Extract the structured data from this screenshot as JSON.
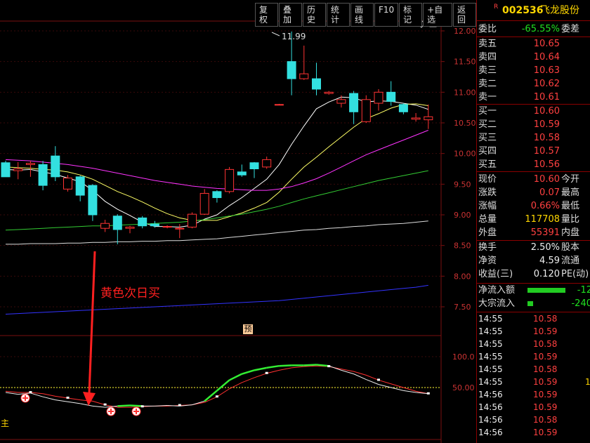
{
  "toolbar": [
    "复权",
    "叠加",
    "历史",
    "统计",
    "画线",
    "F10",
    "标记",
    "+自选",
    "返回"
  ],
  "stock": {
    "badge": "R",
    "code": "002536",
    "name": "飞龙股份"
  },
  "price_axis": [
    "12.00",
    "11.50",
    "11.00",
    "10.50",
    "10.00",
    "9.50",
    "9.00",
    "8.50",
    "8.00",
    "7.50"
  ],
  "indicator_axis": [
    "100.0",
    "50.00"
  ],
  "high_label": "11.99",
  "annotation": "黄色次日买",
  "yu_badge": "预",
  "left_cut_label": "主",
  "order_book": {
    "weibi": {
      "label": "委比",
      "value": "-65.55%",
      "right": "委差"
    },
    "sells": [
      {
        "label": "卖五",
        "price": "10.65"
      },
      {
        "label": "卖四",
        "price": "10.64"
      },
      {
        "label": "卖三",
        "price": "10.63"
      },
      {
        "label": "卖二",
        "price": "10.62"
      },
      {
        "label": "卖一",
        "price": "10.61"
      }
    ],
    "buys": [
      {
        "label": "买一",
        "price": "10.60"
      },
      {
        "label": "买二",
        "price": "10.59"
      },
      {
        "label": "买三",
        "price": "10.58"
      },
      {
        "label": "买四",
        "price": "10.57"
      },
      {
        "label": "买五",
        "price": "10.56"
      }
    ]
  },
  "quote": [
    {
      "label": "现价",
      "value": "10.60",
      "right": "今开",
      "color": "red"
    },
    {
      "label": "涨跌",
      "value": "0.07",
      "right": "最高",
      "color": "red"
    },
    {
      "label": "涨幅",
      "value": "0.66%",
      "right": "最低",
      "color": "red"
    },
    {
      "label": "总量",
      "value": "117708",
      "right": "量比",
      "color": "yellow"
    },
    {
      "label": "外盘",
      "value": "55391",
      "right": "内盘",
      "color": "red"
    }
  ],
  "fundamentals": [
    {
      "label": "换手",
      "value": "2.50%",
      "right": "股本"
    },
    {
      "label": "净资",
      "value": "4.59",
      "right": "流通"
    },
    {
      "label": "收益(三)",
      "value": "0.120",
      "right": "PE(动)"
    }
  ],
  "flows": [
    {
      "label": "净流入额",
      "value": "-12"
    },
    {
      "label": "大宗流入",
      "value": "-240"
    }
  ],
  "ticks": [
    {
      "time": "14:55",
      "price": "10.58",
      "extra": ""
    },
    {
      "time": "14:55",
      "price": "10.59",
      "extra": ""
    },
    {
      "time": "14:55",
      "price": "10.58",
      "extra": ""
    },
    {
      "time": "14:55",
      "price": "10.59",
      "extra": ""
    },
    {
      "time": "14:55",
      "price": "10.58",
      "extra": ""
    },
    {
      "time": "14:55",
      "price": "10.59",
      "extra": "1"
    },
    {
      "time": "14:56",
      "price": "10.59",
      "extra": ""
    },
    {
      "time": "14:56",
      "price": "10.59",
      "extra": ""
    },
    {
      "time": "14:56",
      "price": "10.58",
      "extra": ""
    },
    {
      "time": "14:56",
      "price": "10.59",
      "extra": ""
    }
  ],
  "candles": [
    {
      "o": 9.85,
      "h": 9.88,
      "l": 9.62,
      "c": 9.62
    },
    {
      "o": 9.72,
      "h": 9.86,
      "l": 9.58,
      "c": 9.75
    },
    {
      "o": 9.82,
      "h": 9.88,
      "l": 9.62,
      "c": 9.84
    },
    {
      "o": 9.82,
      "h": 9.88,
      "l": 9.4,
      "c": 9.48
    },
    {
      "o": 9.96,
      "h": 10.12,
      "l": 9.55,
      "c": 9.62
    },
    {
      "o": 9.42,
      "h": 9.65,
      "l": 9.38,
      "c": 9.6
    },
    {
      "o": 9.62,
      "h": 9.64,
      "l": 9.22,
      "c": 9.32
    },
    {
      "o": 9.48,
      "h": 9.5,
      "l": 8.9,
      "c": 9.0
    },
    {
      "o": 8.78,
      "h": 8.92,
      "l": 8.72,
      "c": 8.86
    },
    {
      "o": 8.98,
      "h": 9.01,
      "l": 8.52,
      "c": 8.76
    },
    {
      "o": 8.78,
      "h": 8.82,
      "l": 8.7,
      "c": 8.8
    },
    {
      "o": 8.95,
      "h": 8.98,
      "l": 8.78,
      "c": 8.82
    },
    {
      "o": 8.85,
      "h": 8.9,
      "l": 8.79,
      "c": 8.82
    },
    {
      "o": 8.8,
      "h": 8.83,
      "l": 8.78,
      "c": 8.81
    },
    {
      "o": 8.78,
      "h": 8.85,
      "l": 8.62,
      "c": 8.78
    },
    {
      "o": 8.8,
      "h": 9.04,
      "l": 8.78,
      "c": 9.01
    },
    {
      "o": 9.01,
      "h": 9.42,
      "l": 9.0,
      "c": 9.35
    },
    {
      "o": 9.38,
      "h": 9.4,
      "l": 9.2,
      "c": 9.28
    },
    {
      "o": 9.38,
      "h": 9.78,
      "l": 9.35,
      "c": 9.74
    },
    {
      "o": 9.7,
      "h": 9.82,
      "l": 9.62,
      "c": 9.65
    },
    {
      "o": 9.85,
      "h": 9.86,
      "l": 9.6,
      "c": 9.75
    },
    {
      "o": 9.78,
      "h": 9.95,
      "l": 9.75,
      "c": 9.9
    },
    {
      "o": 10.8,
      "h": 10.81,
      "l": 10.79,
      "c": 10.8
    },
    {
      "o": 11.5,
      "h": 11.99,
      "l": 10.95,
      "c": 11.22
    },
    {
      "o": 11.22,
      "h": 11.76,
      "l": 11.2,
      "c": 11.3
    },
    {
      "o": 11.22,
      "h": 11.48,
      "l": 10.95,
      "c": 11.05
    },
    {
      "o": 10.98,
      "h": 11.02,
      "l": 10.96,
      "c": 11.0
    },
    {
      "o": 10.82,
      "h": 10.95,
      "l": 10.75,
      "c": 10.88
    },
    {
      "o": 10.98,
      "h": 11.02,
      "l": 10.48,
      "c": 10.68
    },
    {
      "o": 10.52,
      "h": 10.95,
      "l": 10.5,
      "c": 10.88
    },
    {
      "o": 10.82,
      "h": 11.05,
      "l": 10.7,
      "c": 11.0
    },
    {
      "o": 11.0,
      "h": 11.18,
      "l": 10.78,
      "c": 10.85
    },
    {
      "o": 10.8,
      "h": 10.82,
      "l": 10.64,
      "c": 10.68
    },
    {
      "o": 10.56,
      "h": 10.66,
      "l": 10.52,
      "c": 10.58
    },
    {
      "o": 10.55,
      "h": 10.8,
      "l": 10.4,
      "c": 10.6
    }
  ],
  "ma_lines": [
    {
      "name": "ma5",
      "color": "#ffffff",
      "values": [
        9.74,
        9.73,
        9.74,
        9.7,
        9.66,
        9.6,
        9.54,
        9.4,
        9.22,
        9.09,
        8.99,
        8.88,
        8.81,
        8.81,
        8.8,
        8.83,
        8.93,
        9.0,
        9.15,
        9.28,
        9.43,
        9.58,
        9.82,
        10.15,
        10.45,
        10.73,
        10.84,
        10.92,
        10.91,
        10.84,
        10.86,
        10.85,
        10.82,
        10.79,
        10.72
      ]
    },
    {
      "name": "ma10",
      "color": "#ffff66",
      "values": [
        9.78,
        9.77,
        9.76,
        9.74,
        9.73,
        9.7,
        9.65,
        9.58,
        9.48,
        9.38,
        9.3,
        9.21,
        9.11,
        9.02,
        8.95,
        8.91,
        8.91,
        8.91,
        8.97,
        9.03,
        9.11,
        9.2,
        9.37,
        9.58,
        9.78,
        9.94,
        10.11,
        10.27,
        10.43,
        10.57,
        10.65,
        10.74,
        10.8,
        10.81,
        10.78
      ]
    },
    {
      "name": "ma20",
      "color": "#ff33ff",
      "values": [
        9.9,
        9.89,
        9.88,
        9.86,
        9.84,
        9.82,
        9.79,
        9.76,
        9.72,
        9.68,
        9.64,
        9.6,
        9.56,
        9.53,
        9.5,
        9.47,
        9.45,
        9.43,
        9.42,
        9.41,
        9.4,
        9.4,
        9.42,
        9.46,
        9.52,
        9.59,
        9.68,
        9.78,
        9.88,
        9.98,
        10.06,
        10.14,
        10.22,
        10.3,
        10.38
      ]
    },
    {
      "name": "ma60",
      "color": "#33cc33",
      "values": [
        8.75,
        8.76,
        8.77,
        8.78,
        8.79,
        8.8,
        8.81,
        8.82,
        8.82,
        8.83,
        8.84,
        8.85,
        8.86,
        8.87,
        8.88,
        8.9,
        8.92,
        8.95,
        8.98,
        9.01,
        9.05,
        9.09,
        9.14,
        9.2,
        9.26,
        9.31,
        9.36,
        9.41,
        9.46,
        9.51,
        9.56,
        9.6,
        9.64,
        9.68,
        9.72
      ]
    },
    {
      "name": "ma120",
      "color": "#dddddd",
      "values": [
        8.52,
        8.52,
        8.53,
        8.53,
        8.53,
        8.54,
        8.54,
        8.55,
        8.55,
        8.56,
        8.56,
        8.57,
        8.57,
        8.58,
        8.58,
        8.59,
        8.6,
        8.61,
        8.63,
        8.65,
        8.67,
        8.69,
        8.71,
        8.73,
        8.75,
        8.76,
        8.78,
        8.79,
        8.81,
        8.82,
        8.84,
        8.85,
        8.86,
        8.88,
        8.9
      ]
    },
    {
      "name": "ma250",
      "color": "#3333ff",
      "values": [
        7.38,
        7.39,
        7.4,
        7.41,
        7.42,
        7.43,
        7.44,
        7.45,
        7.46,
        7.47,
        7.48,
        7.49,
        7.5,
        7.51,
        7.52,
        7.53,
        7.54,
        7.55,
        7.56,
        7.57,
        7.58,
        7.59,
        7.6,
        7.62,
        7.64,
        7.66,
        7.68,
        7.7,
        7.72,
        7.74,
        7.76,
        7.78,
        7.8,
        7.82,
        7.85
      ]
    }
  ],
  "kd": {
    "k": [
      42,
      39,
      41,
      35,
      30,
      27,
      24,
      20,
      18,
      20,
      21,
      20,
      20,
      21,
      20,
      22,
      28,
      45,
      62,
      72,
      78,
      82,
      85,
      86,
      86,
      87,
      85,
      78,
      72,
      63,
      55,
      50,
      45,
      42,
      40
    ],
    "d": [
      44,
      42,
      42,
      40,
      36,
      33,
      30,
      28,
      22,
      18,
      18,
      19,
      20,
      20,
      21,
      22,
      26,
      35,
      48,
      58,
      66,
      73,
      78,
      82,
      84,
      85,
      84,
      80,
      76,
      70,
      62,
      56,
      50,
      44,
      40
    ]
  }
}
